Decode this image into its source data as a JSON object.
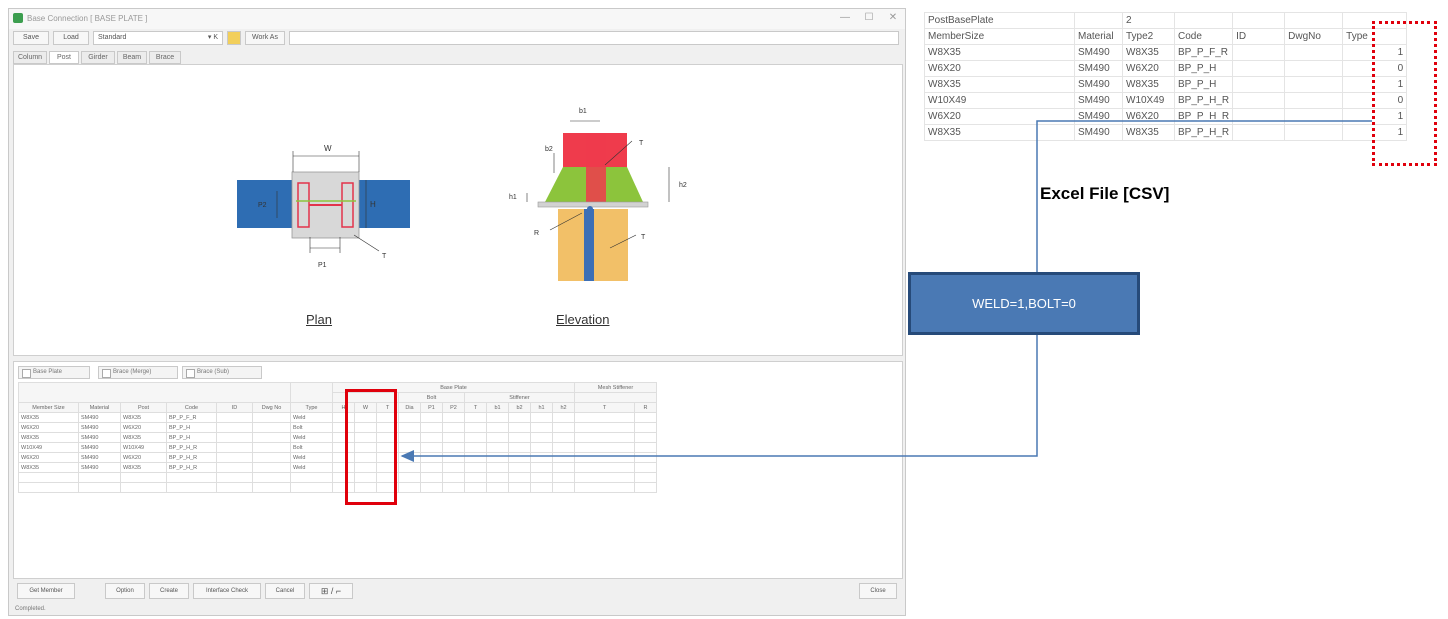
{
  "window": {
    "title": "Base Connection [ BASE PLATE ]",
    "controls": [
      "—",
      "☐",
      "✕"
    ]
  },
  "toolbar": {
    "save": "Save",
    "load": "Load",
    "standard": "Standard",
    "standard_value": "▾ K",
    "work_as": "Work As"
  },
  "tabs": [
    "Column",
    "Post",
    "Girder",
    "Beam",
    "Brace"
  ],
  "drawing": {
    "plan_caption": "Plan",
    "elevation_caption": "Elevation",
    "labels": {
      "W": "W",
      "H": "H",
      "P2": "P2",
      "P1": "P1",
      "T_plan": "T",
      "b1": "b1",
      "b2": "b2",
      "T_top": "T",
      "h2": "h2",
      "h1": "h1",
      "R": "R",
      "T_bottom": "T"
    },
    "colors": {
      "column_blue": "#2e6db3",
      "plate_gray": "#d4d4d4",
      "h_section_red": "#e2334b",
      "top_red": "#ef3b4c",
      "stiffener_green": "#8cc43c",
      "lower_orange": "#f2c068",
      "steel_blue": "#3d6fb5"
    }
  },
  "grid_tabs": [
    "Base Plate",
    "Brace (Merge)",
    "Brace (Sub)"
  ],
  "grid": {
    "group_headers": {
      "base_plate": "Base Plate",
      "bolt": "Bolt",
      "stiffener": "Stiffener",
      "mesh_stiffener": "Mesh Stiffener"
    },
    "headers": [
      "Member Size",
      "Material",
      "Post",
      "Code",
      "ID",
      "Dwg No",
      "Type",
      "H",
      "W",
      "T",
      "Dia",
      "P1",
      "P2",
      "T",
      "b1",
      "b2",
      "h1",
      "h2",
      "T",
      "R"
    ],
    "rows": [
      [
        "W8X35",
        "SM490",
        "W8X35",
        "BP_P_F_R",
        "",
        "",
        "Weld"
      ],
      [
        "W6X20",
        "SM490",
        "W6X20",
        "BP_P_H",
        "",
        "",
        "Bolt"
      ],
      [
        "W8X35",
        "SM490",
        "W8X35",
        "BP_P_H",
        "",
        "",
        "Weld"
      ],
      [
        "W10X49",
        "SM490",
        "W10X49",
        "BP_P_H_R",
        "",
        "",
        "Bolt"
      ],
      [
        "W6X20",
        "SM490",
        "W6X20",
        "BP_P_H_R",
        "",
        "",
        "Weld"
      ],
      [
        "W8X35",
        "SM490",
        "W8X35",
        "BP_P_H_R",
        "",
        "",
        "Weld"
      ]
    ]
  },
  "bottom_buttons": [
    "Get Member",
    "Option",
    "Create",
    "Interface Check",
    "Cancel",
    "Close"
  ],
  "glyph_button": "⊞ / ⌐",
  "status": "Completed.",
  "excel": {
    "title_row": [
      "PostBasePlate",
      "",
      "2",
      "",
      "",
      "",
      ""
    ],
    "header_row": [
      "MemberSize",
      "Material",
      "Type2",
      "Code",
      "ID",
      "DwgNo",
      "Type"
    ],
    "rows": [
      [
        "W8X35",
        "SM490",
        "W8X35",
        "BP_P_F_R",
        "",
        "",
        "1"
      ],
      [
        "W6X20",
        "SM490",
        "W6X20",
        "BP_P_H",
        "",
        "",
        "0"
      ],
      [
        "W8X35",
        "SM490",
        "W8X35",
        "BP_P_H",
        "",
        "",
        "1"
      ],
      [
        "W10X49",
        "SM490",
        "W10X49",
        "BP_P_H_R",
        "",
        "",
        "0"
      ],
      [
        "W6X20",
        "SM490",
        "W6X20",
        "BP_P_H_R",
        "",
        "",
        "1"
      ],
      [
        "W8X35",
        "SM490",
        "W8X35",
        "BP_P_H_R",
        "",
        "",
        "1"
      ]
    ],
    "label": "Excel File [CSV]"
  },
  "callout": {
    "text": "WELD=1,BOLT=0",
    "fill": "#4a79b4",
    "border": "#264a79",
    "line_color": "#4a79b4",
    "highlight_color": "#e0000c"
  }
}
